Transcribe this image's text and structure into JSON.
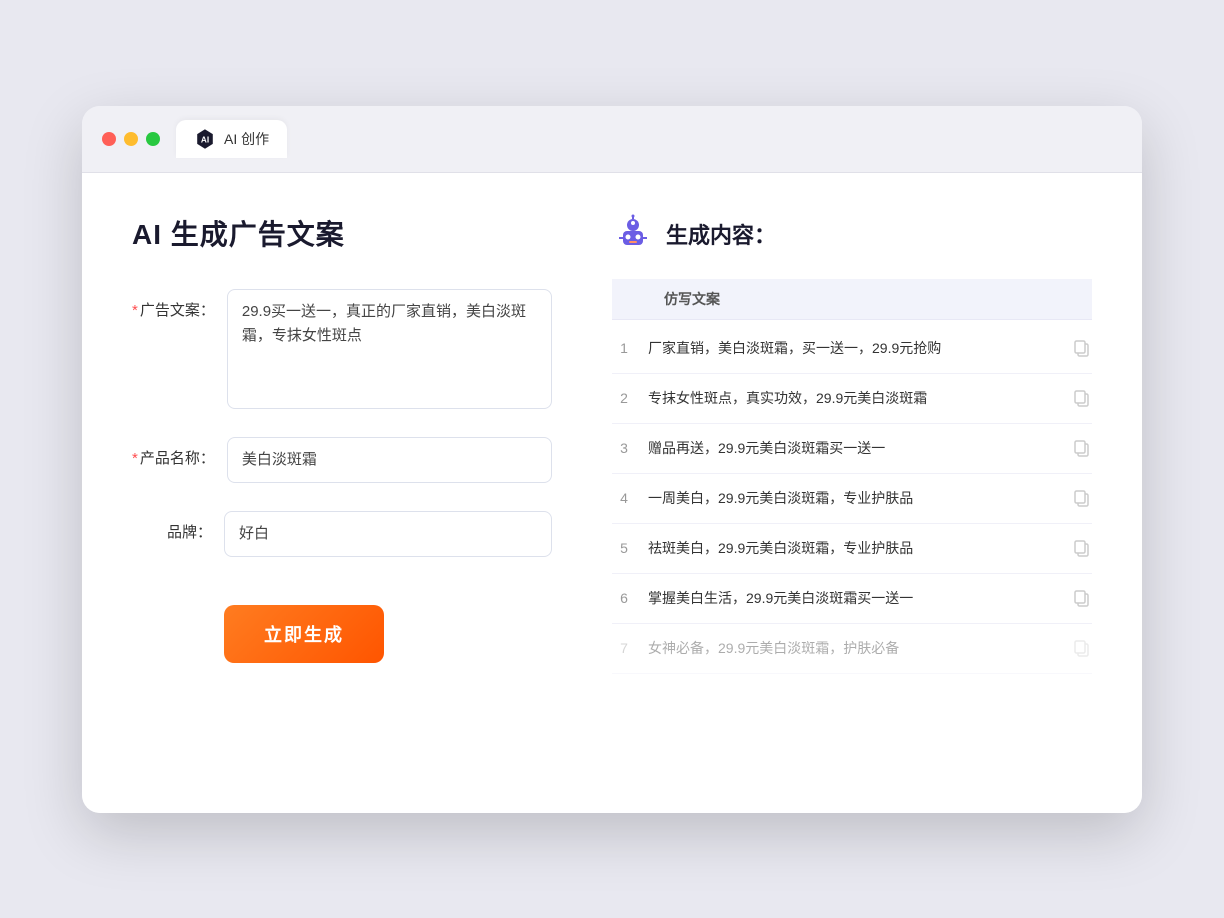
{
  "browser": {
    "tab_label": "AI 创作"
  },
  "page": {
    "title": "AI 生成广告文案",
    "result_title": "生成内容："
  },
  "form": {
    "ad_copy_label": "广告文案：",
    "ad_copy_value": "29.9买一送一，真正的厂家直销，美白淡斑霜，专抹女性斑点",
    "product_name_label": "产品名称：",
    "product_name_value": "美白淡斑霜",
    "brand_label": "品牌：",
    "brand_value": "好白",
    "generate_btn_label": "立即生成"
  },
  "result": {
    "table_header": "仿写文案",
    "items": [
      {
        "num": "1",
        "text": "厂家直销，美白淡斑霜，买一送一，29.9元抢购"
      },
      {
        "num": "2",
        "text": "专抹女性斑点，真实功效，29.9元美白淡斑霜"
      },
      {
        "num": "3",
        "text": "赠品再送，29.9元美白淡斑霜买一送一"
      },
      {
        "num": "4",
        "text": "一周美白，29.9元美白淡斑霜，专业护肤品"
      },
      {
        "num": "5",
        "text": "祛斑美白，29.9元美白淡斑霜，专业护肤品"
      },
      {
        "num": "6",
        "text": "掌握美白生活，29.9元美白淡斑霜买一送一"
      },
      {
        "num": "7",
        "text": "女神必备，29.9元美白淡斑霜，护肤必备",
        "faded": true
      }
    ]
  }
}
